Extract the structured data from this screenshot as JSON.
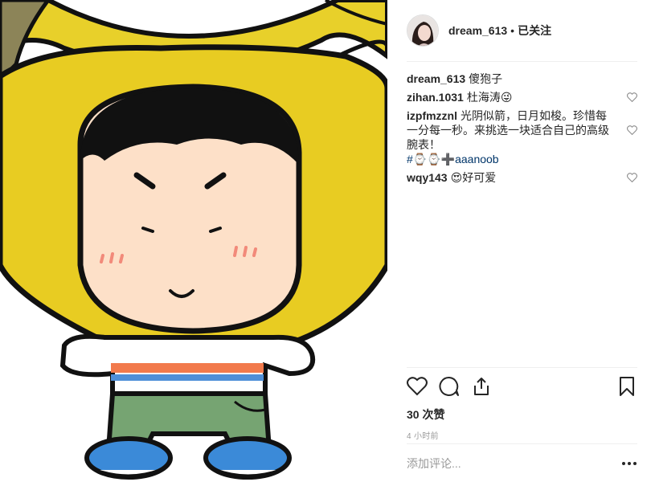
{
  "post": {
    "username": "dream_613",
    "separator": "•",
    "follow_status": "已关注",
    "caption_user": "dream_613",
    "caption_text": "傻狍子"
  },
  "comments": [
    {
      "user": "zihan.1031",
      "text": "杜海涛😜"
    },
    {
      "user": "izpfmzznl",
      "text": "光阴似箭，日月如梭。珍惜每一分每一秒。来挑选一块适合自己的高级腕表！",
      "tags": "#⌚⌚➕aaanoob"
    },
    {
      "user": "wqy143",
      "text": "😍好可爱"
    }
  ],
  "actions": {
    "likes": "30 次赞",
    "time": "4 小时前"
  },
  "add_comment": {
    "placeholder": "添加评论..."
  },
  "colors": {
    "banana": "#f0d82c",
    "skin": "#fde0c8",
    "stripe": "#f27a4c",
    "pants": "#76a472",
    "shoes": "#3b8ad8"
  }
}
